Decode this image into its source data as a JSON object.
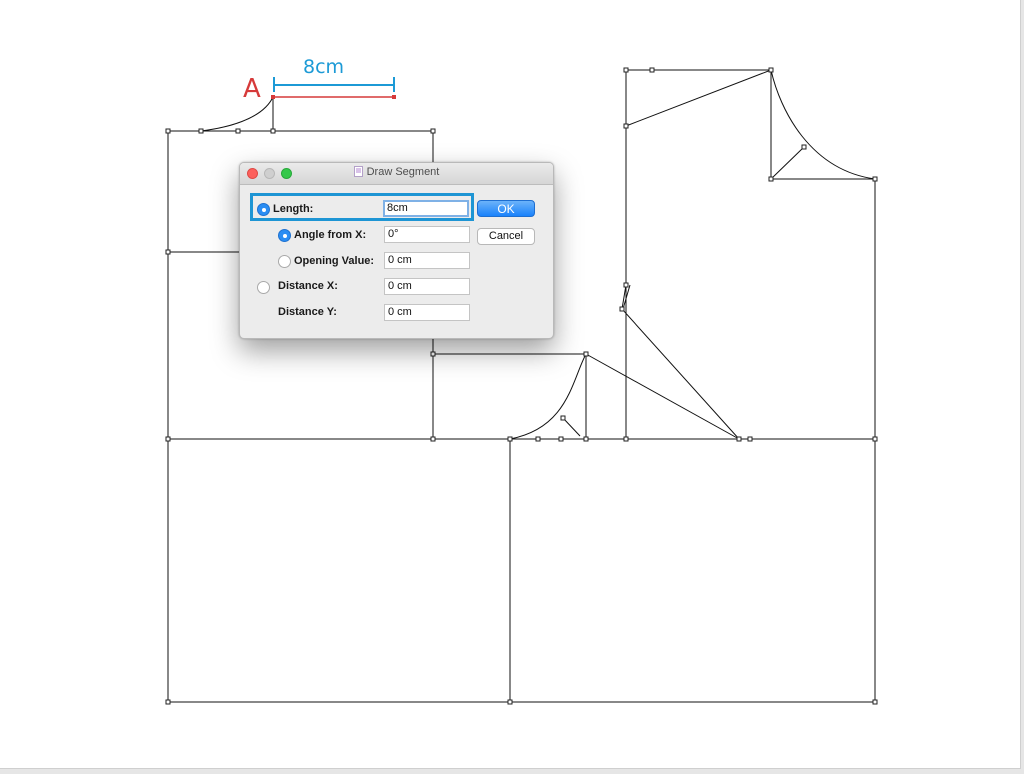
{
  "annotation": {
    "point_label": "A",
    "dimension_label": "8cm",
    "point_color": "#d63a3a",
    "dimension_color": "#1c9ad6",
    "highlight_color": "#1e95d4"
  },
  "dialog": {
    "title": "Draw Segment",
    "window_controls": [
      "close-icon",
      "minimize-icon",
      "zoom-icon"
    ],
    "ok_label": "OK",
    "cancel_label": "Cancel",
    "options": {
      "length": {
        "label": "Length:",
        "value": "8cm",
        "selected": true
      },
      "angle_from_x": {
        "label": "Angle from X:",
        "value": "0°",
        "selected": true
      },
      "opening_value": {
        "label": "Opening Value:",
        "value": "0 cm",
        "selected": false
      },
      "distance_x": {
        "label": "Distance X:",
        "value": "0 cm",
        "selected": false
      },
      "distance_y": {
        "label": "Distance Y:",
        "value": "0 cm"
      }
    }
  }
}
